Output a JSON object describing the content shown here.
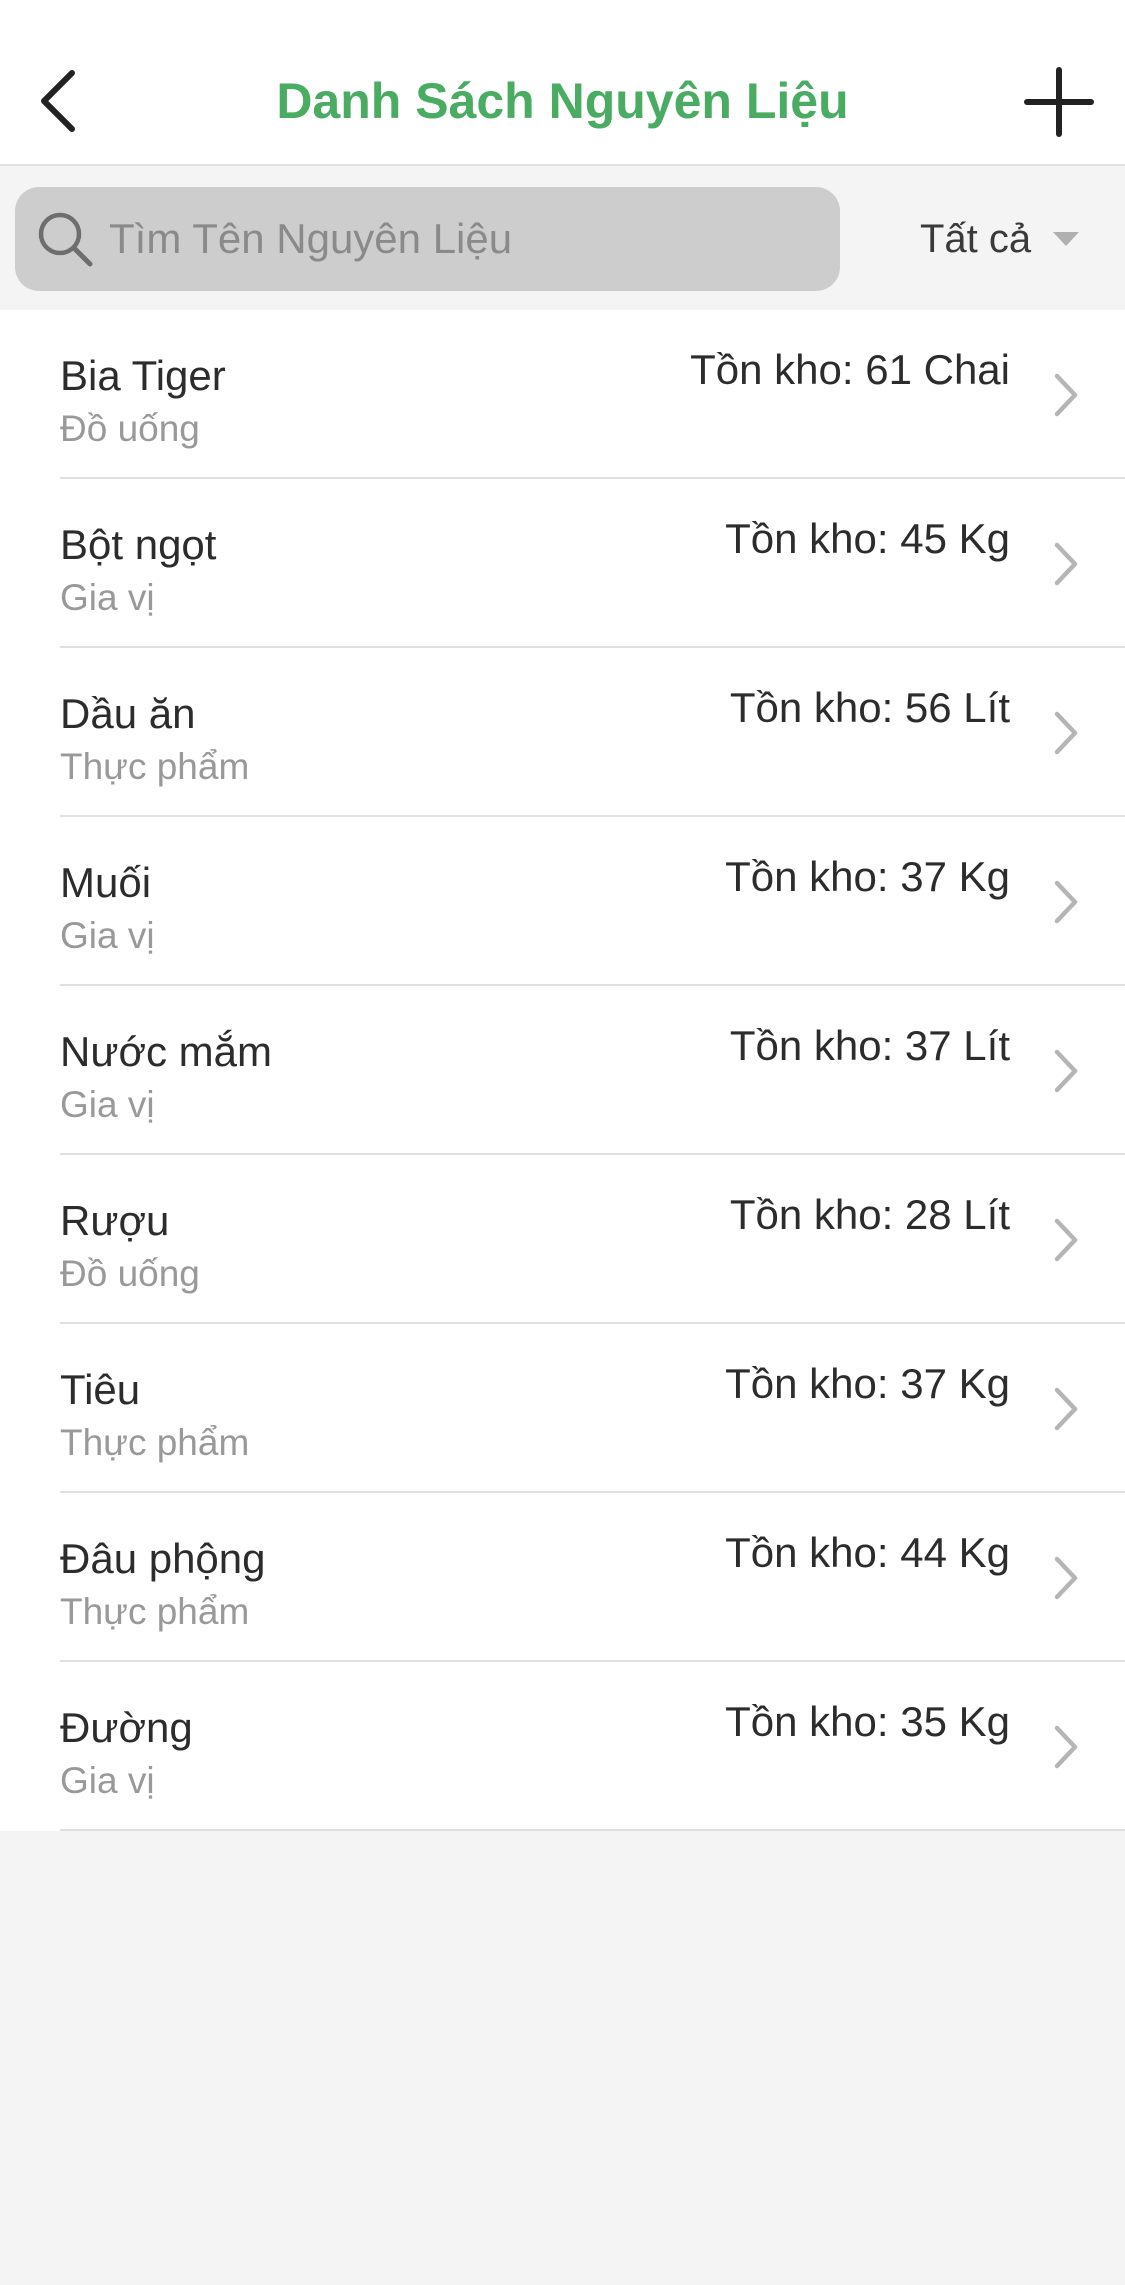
{
  "header": {
    "title": "Danh Sách Nguyên Liệu",
    "back_icon": "chevron-left-icon",
    "add_icon": "plus-icon"
  },
  "search": {
    "placeholder": "Tìm Tên Nguyên Liệu",
    "value": "",
    "icon": "search-icon"
  },
  "filter": {
    "selected": "Tất cả",
    "icon": "caret-down-icon"
  },
  "colors": {
    "accent": "#4aab63",
    "search_bg": "#cdcdcd",
    "secondary_text": "#999999",
    "chevron": "#b5b5b5"
  },
  "items": [
    {
      "name": "Bia Tiger",
      "category": "Đồ uống",
      "stock": "Tồn kho: 61 Chai"
    },
    {
      "name": "Bột ngọt",
      "category": "Gia vị",
      "stock": "Tồn kho: 45 Kg"
    },
    {
      "name": "Dầu ăn",
      "category": "Thực phẩm",
      "stock": "Tồn kho: 56 Lít"
    },
    {
      "name": "Muối",
      "category": "Gia vị",
      "stock": "Tồn kho: 37 Kg"
    },
    {
      "name": "Nước mắm",
      "category": "Gia vị",
      "stock": "Tồn kho: 37 Lít"
    },
    {
      "name": "Rượu",
      "category": "Đồ uống",
      "stock": "Tồn kho: 28 Lít"
    },
    {
      "name": "Tiêu",
      "category": "Thực phẩm",
      "stock": "Tồn kho: 37 Kg"
    },
    {
      "name": "Đâu phộng",
      "category": "Thực phẩm",
      "stock": "Tồn kho: 44 Kg"
    },
    {
      "name": "Đường",
      "category": "Gia vị",
      "stock": "Tồn kho: 35 Kg"
    }
  ]
}
